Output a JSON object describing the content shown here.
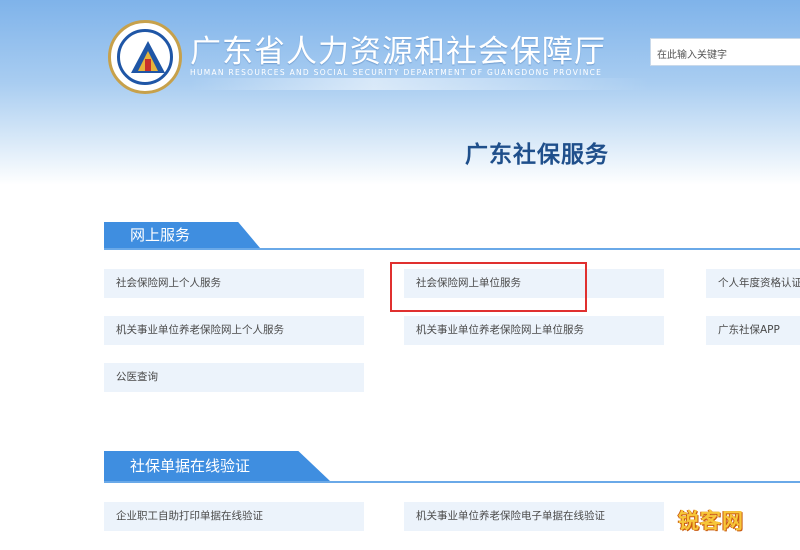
{
  "header": {
    "title": "广东省人力资源和社会保障厅",
    "subtitle": "HUMAN RESOURCES AND SOCIAL SECURITY DEPARTMENT OF GUANGDONG PROVINCE",
    "search_placeholder": "在此输入关键字"
  },
  "page_title": "广东社保服务",
  "sections": [
    {
      "title": "网上服务",
      "items": [
        "社会保险网上个人服务",
        "社会保险网上单位服务",
        "个人年度资格认证",
        "机关事业单位养老保险网上个人服务",
        "机关事业单位养老保险网上单位服务",
        "广东社保APP",
        "公医查询"
      ]
    },
    {
      "title": "社保单据在线验证",
      "items": [
        "企业职工自助打印单据在线验证",
        "机关事业单位养老保险电子单据在线验证"
      ]
    }
  ],
  "highlighted_item": "社会保险网上单位服务",
  "watermark": "锐客网",
  "colors": {
    "tab_blue": "#3f8ee0",
    "item_bg": "#ecf3fb",
    "heading": "#1f4f8b",
    "highlight_border": "#e0302f"
  }
}
